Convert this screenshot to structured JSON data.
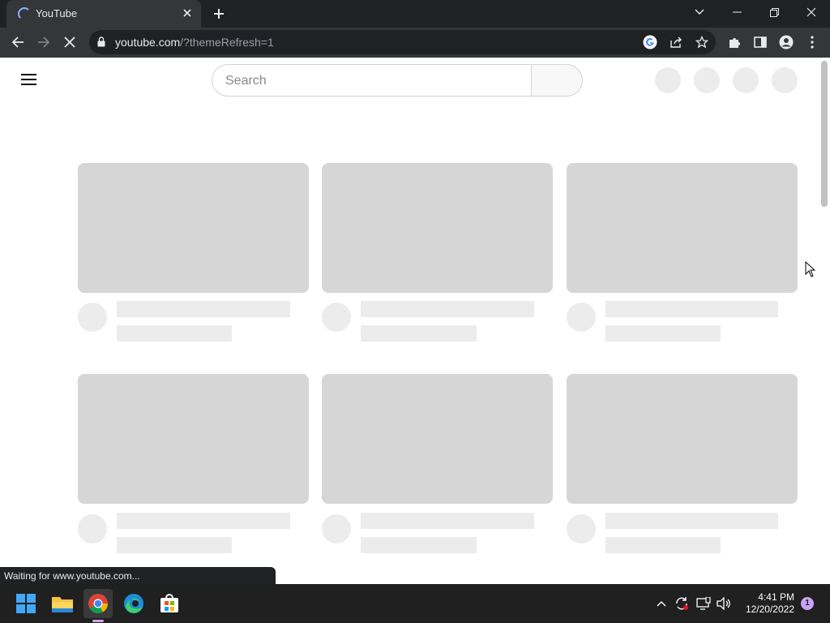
{
  "browser": {
    "tab_title": "YouTube",
    "url_host": "youtube.com",
    "url_path": "/?themeRefresh=1",
    "status_text": "Waiting for www.youtube.com...",
    "icons": {
      "tab_loading": "loading-spinner-icon",
      "tab_close": "close-icon",
      "new_tab": "plus-icon",
      "tab_search": "chevron-down-icon",
      "minimize": "minimize-icon",
      "restore": "restore-icon",
      "close_window": "close-icon",
      "back": "arrow-left-icon",
      "forward": "arrow-right-icon",
      "stop": "close-icon",
      "lock": "lock-icon",
      "google": "google-icon",
      "share": "share-icon",
      "bookmark": "star-icon",
      "extensions": "puzzle-icon",
      "side_panel": "side-panel-icon",
      "profile": "person-icon",
      "menu": "more-vert-icon"
    }
  },
  "youtube": {
    "search_placeholder": "Search",
    "menu_icon": "hamburger-icon",
    "loading": true
  },
  "taskbar": {
    "time": "4:41 PM",
    "date": "12/20/2022",
    "notification_count": "1",
    "apps": [
      "start-icon",
      "file-explorer-icon",
      "chrome-icon",
      "edge-icon",
      "store-icon"
    ],
    "tray": [
      "chevron-up-icon",
      "sync-icon",
      "network-icon",
      "volume-icon"
    ]
  },
  "colors": {
    "chrome_dark": "#202124",
    "chrome_toolbar": "#35363a",
    "placeholder_thumb": "#d6d6d6",
    "placeholder_light": "#ececec",
    "taskbar": "#202020"
  }
}
